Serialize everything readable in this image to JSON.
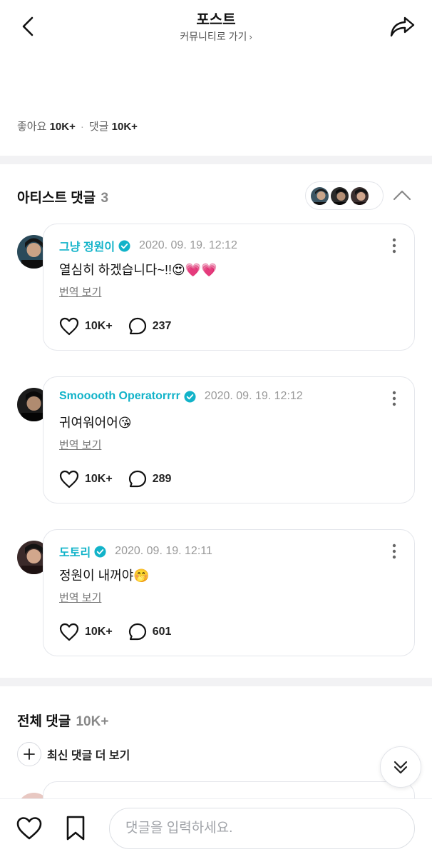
{
  "header": {
    "title": "포스트",
    "community_link": "커뮤니티로 가기",
    "chevron": "›"
  },
  "stats": {
    "likes_label": "좋아요",
    "likes_value": "10K+",
    "separator": "·",
    "comments_label": "댓글",
    "comments_value": "10K+"
  },
  "artist_section": {
    "title": "아티스트 댓글",
    "count": "3",
    "comments": [
      {
        "author": "그냥 정원이",
        "verified": true,
        "date": "2020. 09. 19. 12:12",
        "text": "열심히 하겠습니다~!!😍💗💗",
        "translate": "번역 보기",
        "likes": "10K+",
        "replies": "237",
        "avatar_color": "#2a4a5a"
      },
      {
        "author": "Smooooth Operatorrrr",
        "verified": true,
        "date": "2020. 09. 19. 12:12",
        "text": "귀여워어어😘",
        "translate": "번역 보기",
        "likes": "10K+",
        "replies": "289",
        "avatar_color": "#1a1a1a"
      },
      {
        "author": "도토리",
        "verified": true,
        "date": "2020. 09. 19. 12:11",
        "text": "정원이 내꺼야🤭",
        "translate": "번역 보기",
        "likes": "10K+",
        "replies": "601",
        "avatar_color": "#3a2a2a"
      }
    ]
  },
  "all_section": {
    "title": "전체 댓글",
    "count": "10K+",
    "more_label": "최신 댓글 더 보기"
  },
  "bottom_bar": {
    "input_placeholder": "댓글을 입력하세요."
  },
  "colors": {
    "accent": "#12b3c9",
    "divider": "#f2f2f4",
    "border": "#e4e6eb"
  },
  "icons": {
    "back": "chevron-left-icon",
    "share": "share-arrow-icon",
    "verified": "verified-badge-icon",
    "more": "more-vertical-icon",
    "like": "heart-outline-icon",
    "reply": "speech-bubble-icon",
    "collapse": "chevron-up-icon",
    "scroll": "double-chevron-down-icon",
    "bookmark": "bookmark-icon",
    "add": "plus-icon"
  }
}
